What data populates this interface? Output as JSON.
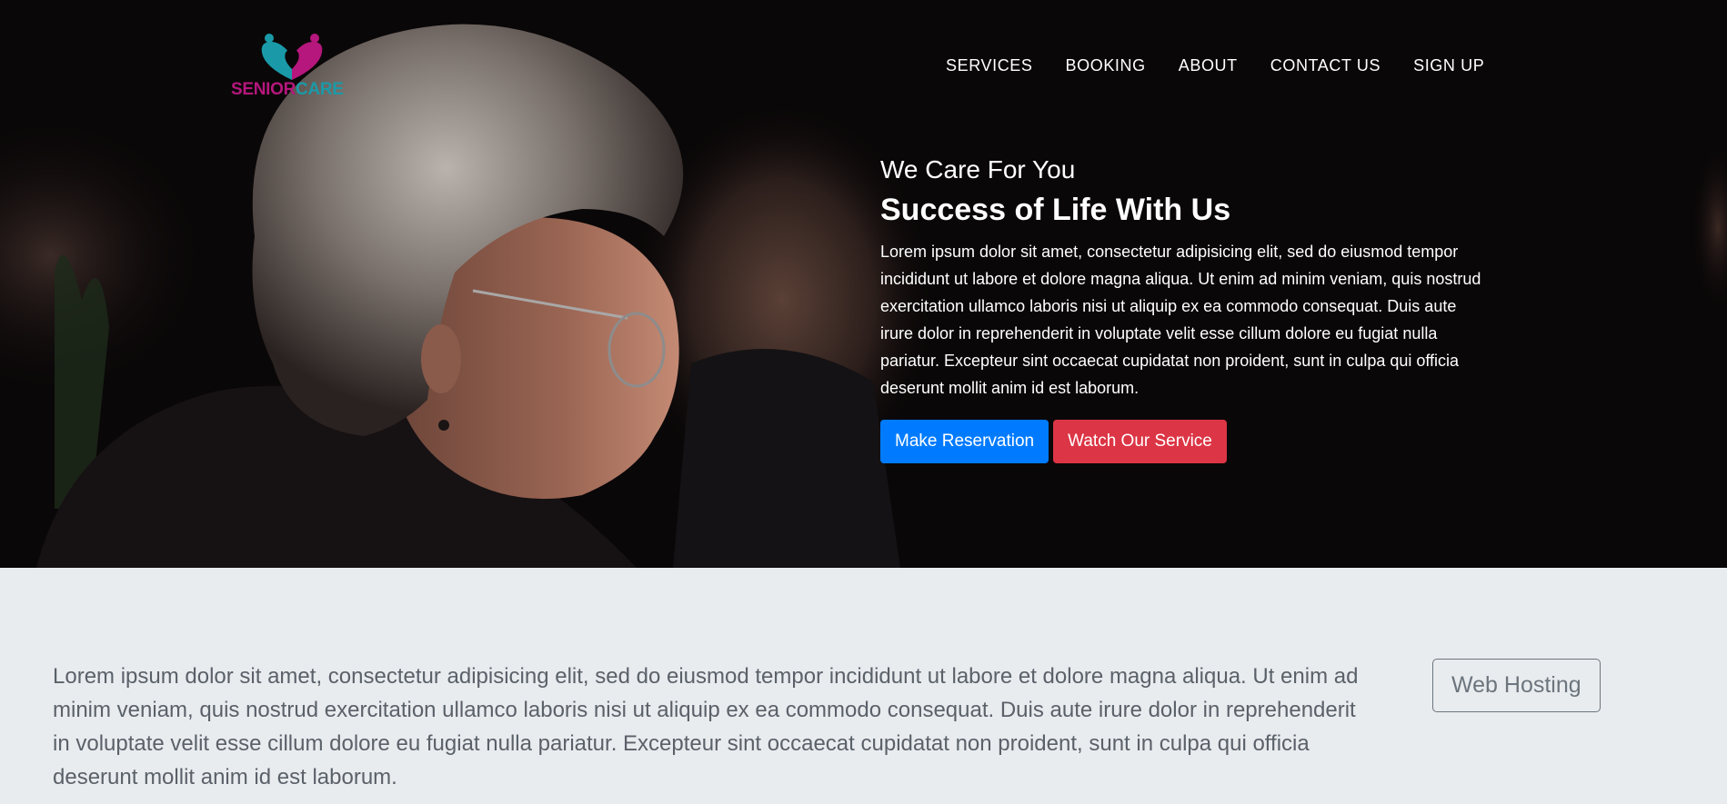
{
  "brand": {
    "name_part1": "SENIOR",
    "name_part2": "CARE",
    "color_primary": "#b5177c",
    "color_secondary": "#1a9aa8"
  },
  "nav": {
    "items": [
      {
        "label": "SERVICES"
      },
      {
        "label": "BOOKING"
      },
      {
        "label": "ABOUT"
      },
      {
        "label": "CONTACT US"
      },
      {
        "label": "SIGN UP"
      }
    ]
  },
  "hero": {
    "kicker": "We Care For You",
    "headline": "Success of Life With Us",
    "text": "Lorem ipsum dolor sit amet, consectetur adipisicing elit, sed do eiusmod tempor incididunt ut labore et dolore magna aliqua. Ut enim ad minim veniam, quis nostrud exercitation ullamco laboris nisi ut aliquip ex ea commodo consequat. Duis aute irure dolor in reprehenderit in voluptate velit esse cillum dolore eu fugiat nulla pariatur. Excepteur sint occaecat cupidatat non proident, sunt in culpa qui officia deserunt mollit anim id est laborum.",
    "primary_button": "Make Reservation",
    "secondary_button": "Watch Our Service",
    "primary_color": "#007bff",
    "secondary_color": "#dc3545"
  },
  "lower": {
    "text": "Lorem ipsum dolor sit amet, consectetur adipisicing elit, sed do eiusmod tempor incididunt ut labore et dolore magna aliqua. Ut enim ad minim veniam, quis nostrud exercitation ullamco laboris nisi ut aliquip ex ea commodo consequat. Duis aute irure dolor in reprehenderit in voluptate velit esse cillum dolore eu fugiat nulla pariatur. Excepteur sint occaecat cupidatat non proident, sunt in culpa qui officia deserunt mollit anim id est laborum.",
    "button_label": "Web Hosting"
  },
  "icons": {
    "logo": "heart-people-logo-icon"
  }
}
